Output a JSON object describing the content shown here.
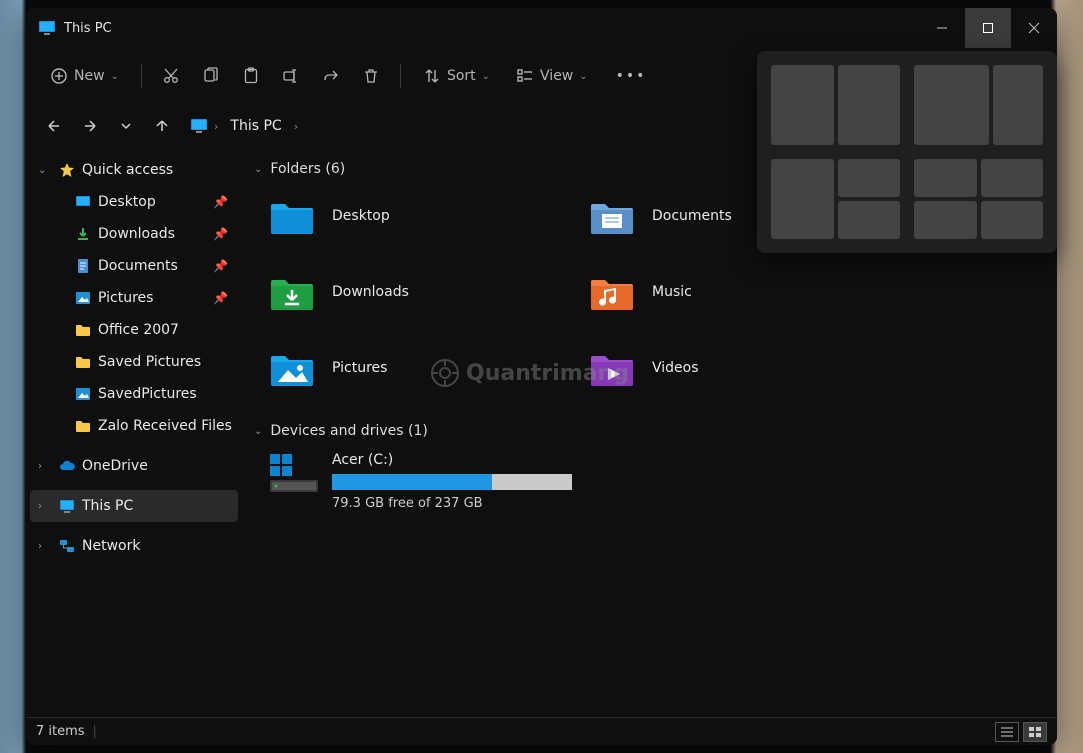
{
  "titlebar": {
    "title": "This PC"
  },
  "toolbar": {
    "new_label": "New",
    "sort_label": "Sort",
    "view_label": "View"
  },
  "breadcrumb": {
    "location": "This PC"
  },
  "sidebar": {
    "quick_access": "Quick access",
    "items": [
      {
        "label": "Desktop",
        "pinned": true
      },
      {
        "label": "Downloads",
        "pinned": true
      },
      {
        "label": "Documents",
        "pinned": true
      },
      {
        "label": "Pictures",
        "pinned": true
      },
      {
        "label": "Office 2007",
        "pinned": false
      },
      {
        "label": "Saved Pictures",
        "pinned": false
      },
      {
        "label": "SavedPictures",
        "pinned": false
      },
      {
        "label": "Zalo Received Files",
        "pinned": false
      }
    ],
    "onedrive": "OneDrive",
    "this_pc": "This PC",
    "network": "Network"
  },
  "content": {
    "folders_header": "Folders (6)",
    "folders": [
      {
        "label": "Desktop"
      },
      {
        "label": "Documents"
      },
      {
        "label": "Downloads"
      },
      {
        "label": "Music"
      },
      {
        "label": "Pictures"
      },
      {
        "label": "Videos"
      }
    ],
    "drives_header": "Devices and drives (1)",
    "drive": {
      "name": "Acer (C:)",
      "free_text": "79.3 GB free of 237 GB",
      "fill_pct": 66.5
    }
  },
  "statusbar": {
    "count_text": "7 items"
  },
  "watermark": "Quantrimang"
}
